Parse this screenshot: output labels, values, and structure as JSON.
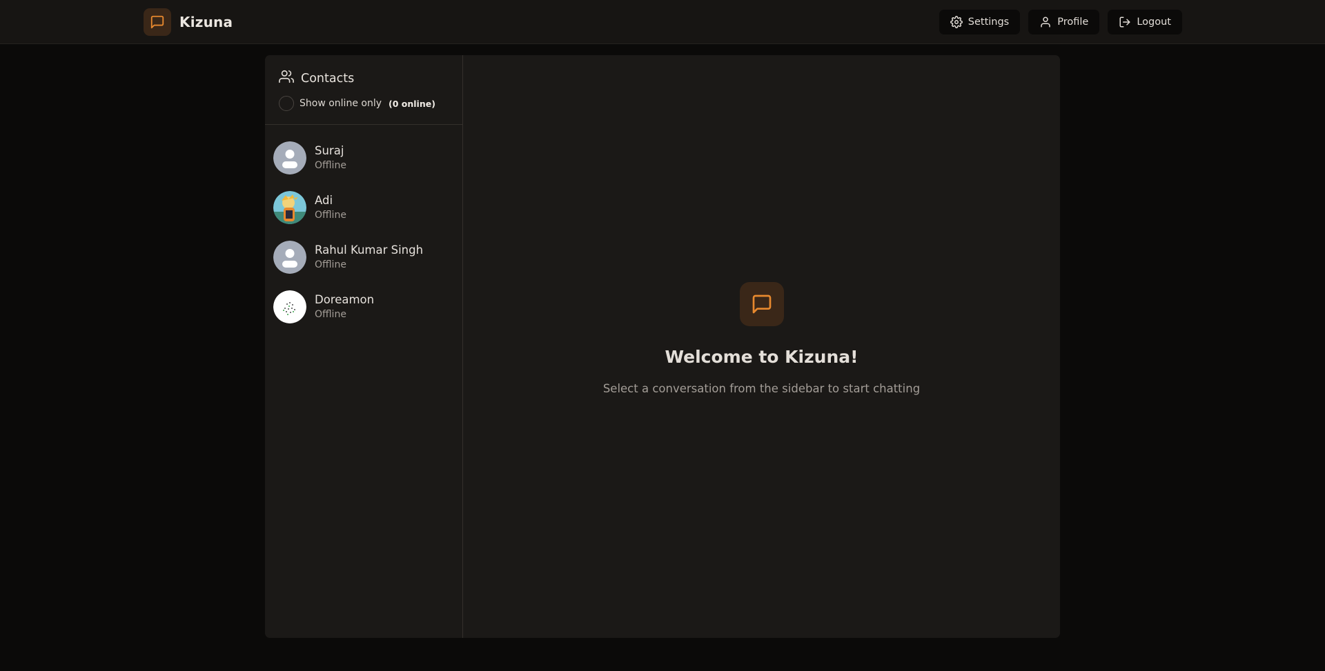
{
  "app": {
    "name": "Kizuna",
    "accent": "#e8892e"
  },
  "nav": {
    "settings_label": "Settings",
    "profile_label": "Profile",
    "logout_label": "Logout"
  },
  "sidebar": {
    "title": "Contacts",
    "filter_label": "Show online only",
    "online_count": "(0 online)",
    "contacts": [
      {
        "name": "Suraj",
        "status": "Offline",
        "avatar": "default-avatar"
      },
      {
        "name": "Adi",
        "status": "Offline",
        "avatar": "photo-avatar"
      },
      {
        "name": "Rahul Kumar Singh",
        "status": "Offline",
        "avatar": "default-avatar"
      },
      {
        "name": "Doreamon",
        "status": "Offline",
        "avatar": "photo-avatar"
      }
    ]
  },
  "welcome": {
    "title": "Welcome to Kizuna!",
    "subtitle": "Select a conversation from the sidebar to start chatting"
  },
  "icons": {
    "brand": "message-square-icon",
    "settings": "gear-icon",
    "profile": "user-icon",
    "logout": "logout-icon",
    "contacts": "users-icon"
  }
}
